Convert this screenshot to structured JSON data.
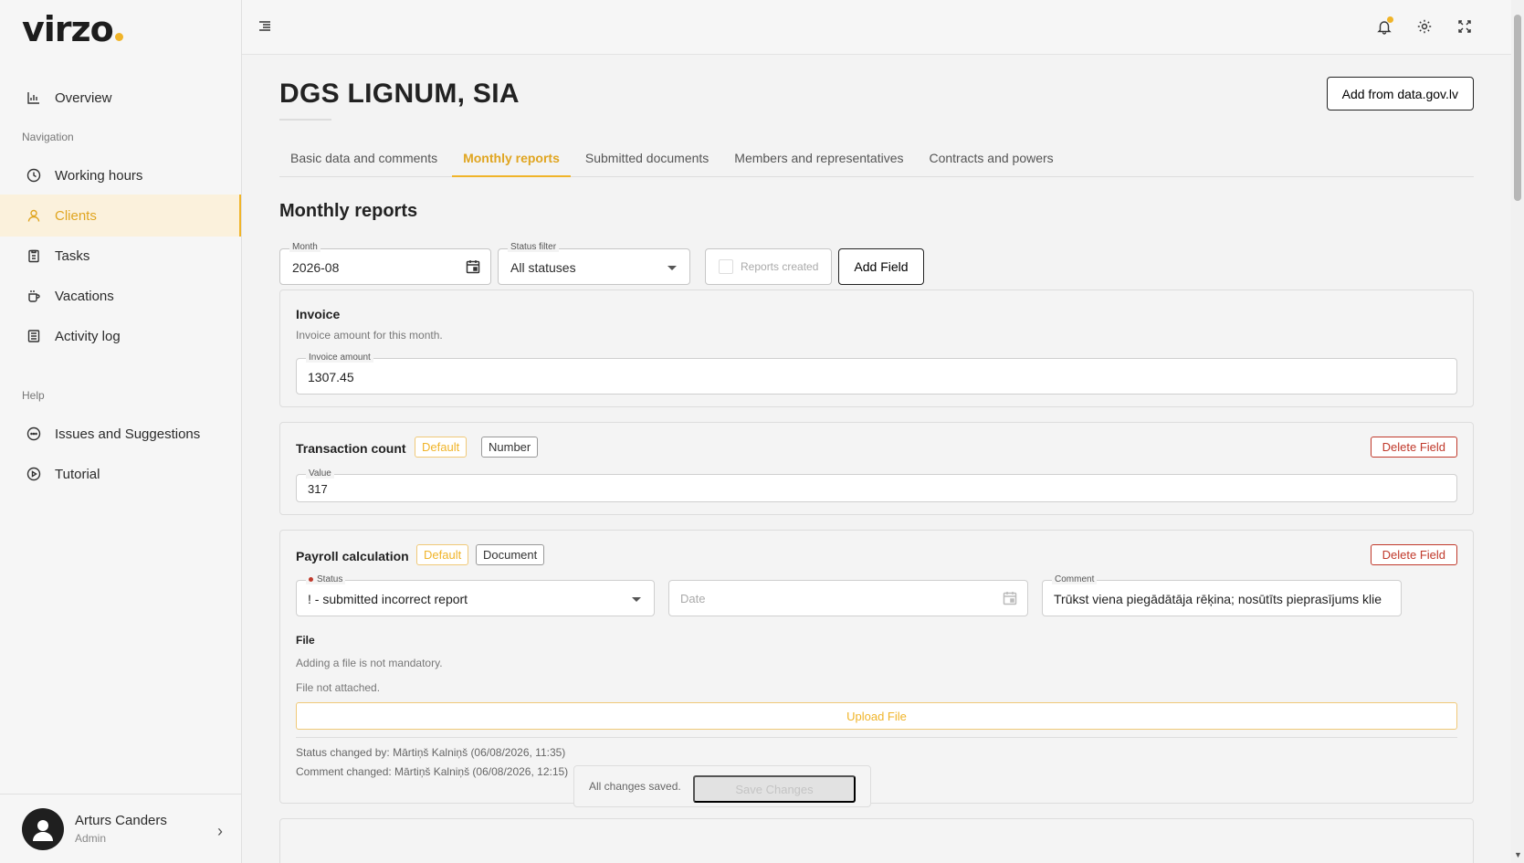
{
  "brand": {
    "name": "virzo",
    "accent": "#f0b429"
  },
  "sidebar": {
    "overview": "Overview",
    "nav_section": "Navigation",
    "nav_items": [
      {
        "label": "Working hours",
        "icon": "clock-icon"
      },
      {
        "label": "Clients",
        "icon": "user-icon",
        "active": true
      },
      {
        "label": "Tasks",
        "icon": "clipboard-icon"
      },
      {
        "label": "Vacations",
        "icon": "coffee-icon"
      },
      {
        "label": "Activity log",
        "icon": "list-icon"
      }
    ],
    "help_section": "Help",
    "help_items": [
      {
        "label": "Issues and Suggestions",
        "icon": "chat-icon"
      },
      {
        "label": "Tutorial",
        "icon": "play-icon"
      }
    ],
    "user": {
      "name": "Arturs Canders",
      "role": "Admin"
    }
  },
  "header": {
    "client_name": "DGS LIGNUM, SIA",
    "add_gov_button": "Add from data.gov.lv"
  },
  "tabs": [
    {
      "label": "Basic data and comments"
    },
    {
      "label": "Monthly reports",
      "active": true
    },
    {
      "label": "Submitted documents"
    },
    {
      "label": "Members and representatives"
    },
    {
      "label": "Contracts and powers"
    }
  ],
  "reports": {
    "title": "Monthly reports",
    "month_label": "Month",
    "month_value": "2026-08",
    "status_filter_label": "Status filter",
    "status_filter_value": "All statuses",
    "reports_created_label": "Reports created",
    "add_field_button": "Add Field"
  },
  "invoice_card": {
    "title": "Invoice",
    "description": "Invoice amount for this month.",
    "field_label": "Invoice amount",
    "field_value": "1307.45"
  },
  "transaction_card": {
    "title": "Transaction count",
    "badge_default": "Default",
    "badge_type": "Number",
    "delete_button": "Delete Field",
    "field_label": "Value",
    "field_value": "317"
  },
  "payroll_card": {
    "title": "Payroll calculation",
    "badge_default": "Default",
    "badge_type": "Document",
    "delete_button": "Delete Field",
    "status_label": "Status",
    "status_value": "! - submitted incorrect report",
    "date_placeholder": "Date",
    "comment_label": "Comment",
    "comment_value": "Trūkst viena piegādātāja rēķina; nosūtīts pieprasījums klie",
    "file_label": "File",
    "file_hint": "Adding a file is not mandatory.",
    "file_status": "File not attached.",
    "upload_button": "Upload File",
    "status_changed": "Status changed by: Mārtiņš Kalniņš (06/08/2026, 11:35)",
    "comment_changed": "Comment changed: Mārtiņš Kalniņš (06/08/2026, 12:15)"
  },
  "save_bar": {
    "status": "All changes saved.",
    "save_button": "Save Changes"
  }
}
